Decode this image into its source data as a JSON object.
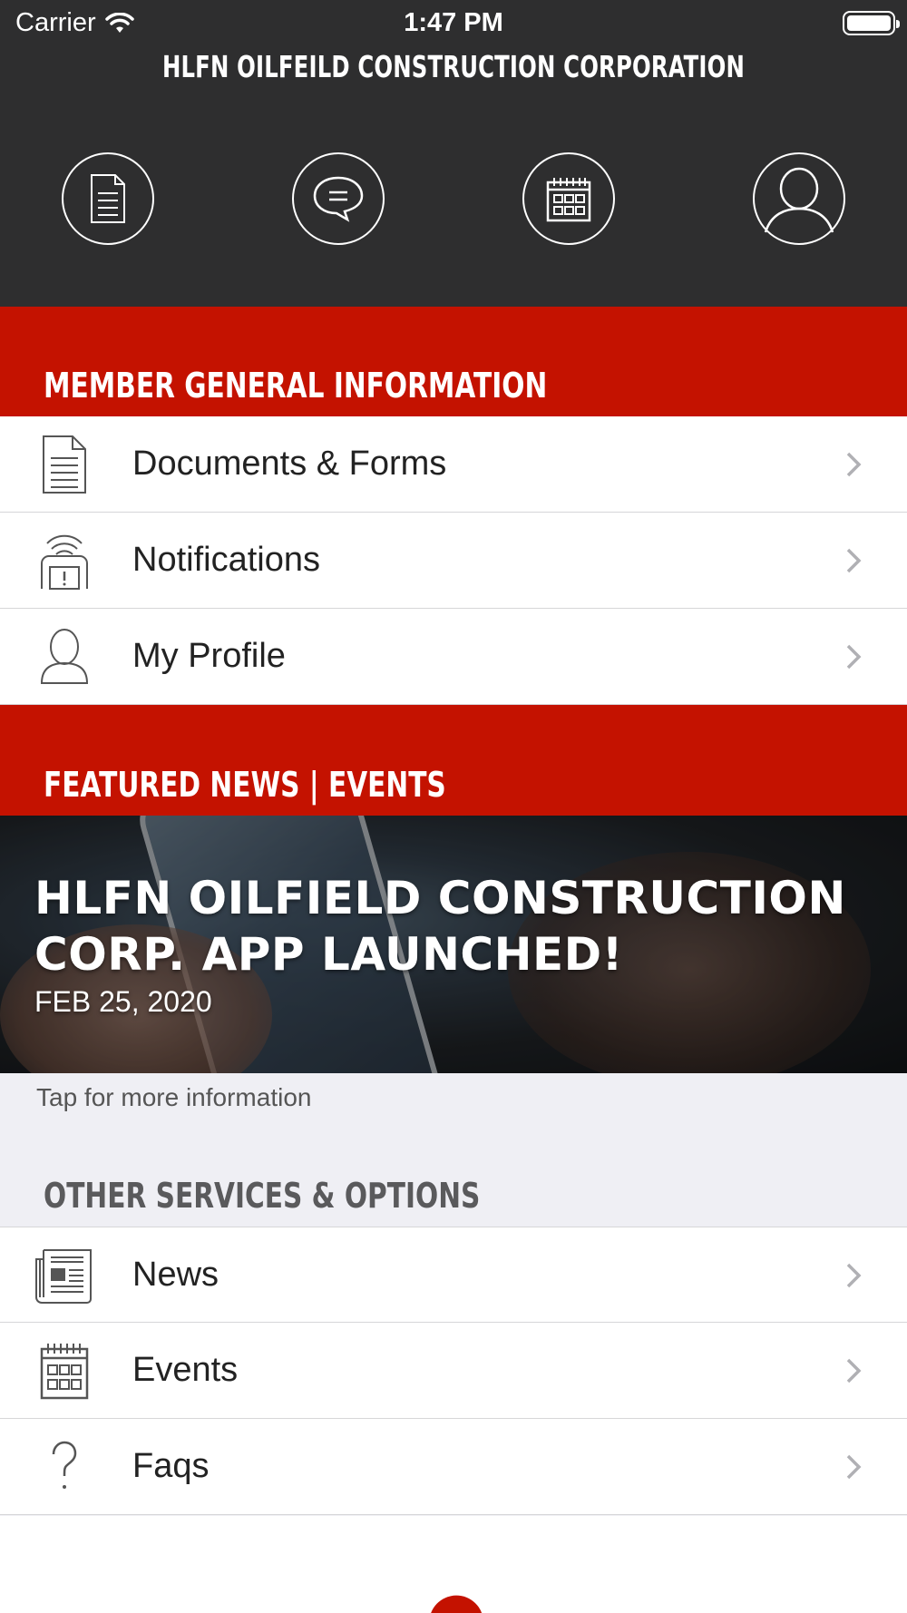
{
  "status_bar": {
    "carrier": "Carrier",
    "time": "1:47 PM"
  },
  "header": {
    "title": "HLFN OILFEILD CONSTRUCTION CORPORATION",
    "quick_actions": [
      {
        "name": "documents",
        "icon": "document-icon"
      },
      {
        "name": "messages",
        "icon": "chat-icon"
      },
      {
        "name": "calendar",
        "icon": "calendar-icon"
      },
      {
        "name": "profile",
        "icon": "user-icon"
      }
    ]
  },
  "member_section": {
    "heading": "MEMBER GENERAL INFORMATION",
    "items": [
      {
        "label": "Documents & Forms",
        "icon": "document-icon"
      },
      {
        "label": "Notifications",
        "icon": "notification-icon"
      },
      {
        "label": "My Profile",
        "icon": "user-icon"
      }
    ]
  },
  "featured": {
    "heading": "FEATURED NEWS | EVENTS",
    "headline": "HLFN OILFIELD CONSTRUCTION CORP. APP LAUNCHED!",
    "date": "FEB 25, 2020",
    "tap_hint": "Tap for more information"
  },
  "other_section": {
    "heading": "OTHER SERVICES & OPTIONS",
    "items": [
      {
        "label": "News",
        "icon": "newspaper-icon"
      },
      {
        "label": "Events",
        "icon": "calendar-icon"
      },
      {
        "label": "Faqs",
        "icon": "question-icon"
      }
    ]
  },
  "colors": {
    "brand_red": "#c41200",
    "header_dark": "#2e2e2f",
    "background": "#efeff4"
  }
}
